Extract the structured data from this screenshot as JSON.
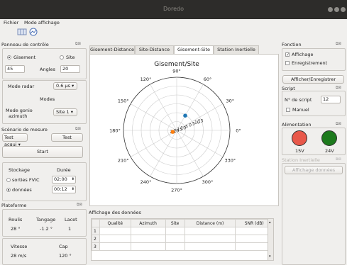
{
  "window": {
    "title": "Doredo"
  },
  "menu": {
    "fichier": "Fichier",
    "mode": "Mode affichage"
  },
  "left": {
    "controle": {
      "title": "Panneau de contrôle",
      "gisement": "Gisement",
      "site": "Site",
      "gisement_value": "45",
      "angles_label": "Angles",
      "site_value": "20",
      "mode_radar_label": "Mode radar",
      "mode_radar_value": "0.6 µs",
      "modes_label": "Modes",
      "mode_gonio_label_1": "Mode gonio",
      "mode_gonio_label_2": "azimuth",
      "mode_gonio_value": "Site 1"
    },
    "scenario": {
      "title": "Scénario de mesure",
      "acqui_value": "Test acqui",
      "test_btn": "Test",
      "start_btn": "Start",
      "stockage": "Stockage",
      "duree": "Durée",
      "sorties": "sorties FVIC",
      "sorties_value": "02:00",
      "donnees": "données",
      "donnees_value": "00:12"
    },
    "plateforme": {
      "title": "Plateforme",
      "roulis": "Roulis",
      "tangage": "Tangage",
      "lacet": "Lacet",
      "roulis_v": "28 °",
      "tangage_v": "-1.2 °",
      "lacet_v": "1",
      "vitesse": "Vitesse",
      "cap": "Cap",
      "vitesse_v": "28 m/s",
      "cap_v": "120 °"
    }
  },
  "center": {
    "tabs": [
      "Gisement-Distance",
      "Site-Distance",
      "Gisement-Site",
      "Station Inertielle"
    ],
    "affichage": {
      "title": "Affichage des données",
      "columns": [
        "Qualité",
        "Azimuth",
        "Site",
        "Distance (m)",
        "SNR (dB)"
      ],
      "rows": [
        "1",
        "2",
        "3"
      ]
    }
  },
  "chart_data": {
    "type": "scatter",
    "title": "Gisement/Site",
    "angle_labels": [
      "0°",
      "30°",
      "60°",
      "90°",
      "120°",
      "150°",
      "180°",
      "210°",
      "240°",
      "270°",
      "300°",
      "330°"
    ],
    "radial_ticks": [
      "25",
      "20",
      "15",
      "10",
      "5",
      "0",
      "5",
      "10",
      "15"
    ],
    "points": [
      {
        "angle": 60,
        "radius": 8,
        "color": "#1f77b4"
      },
      {
        "angle": 200,
        "radius": 2,
        "color": "#ff7f0e"
      }
    ]
  },
  "right": {
    "fonction": {
      "title": "Fonction",
      "affichage": "Affichage",
      "enregistrement": "Enregistrement",
      "btn": "Afficher/Enregistrer"
    },
    "script": {
      "title": "Script",
      "num_label": "N° de script",
      "num_value": "12",
      "manuel": "Manuel"
    },
    "alimentation": {
      "title": "Alimentation",
      "v15": "15V",
      "v24": "24V",
      "c15": "#e8584a",
      "c24": "#1d7a1d"
    },
    "station": {
      "title": "Station Inertielle",
      "btn": "Affichage données"
    }
  }
}
